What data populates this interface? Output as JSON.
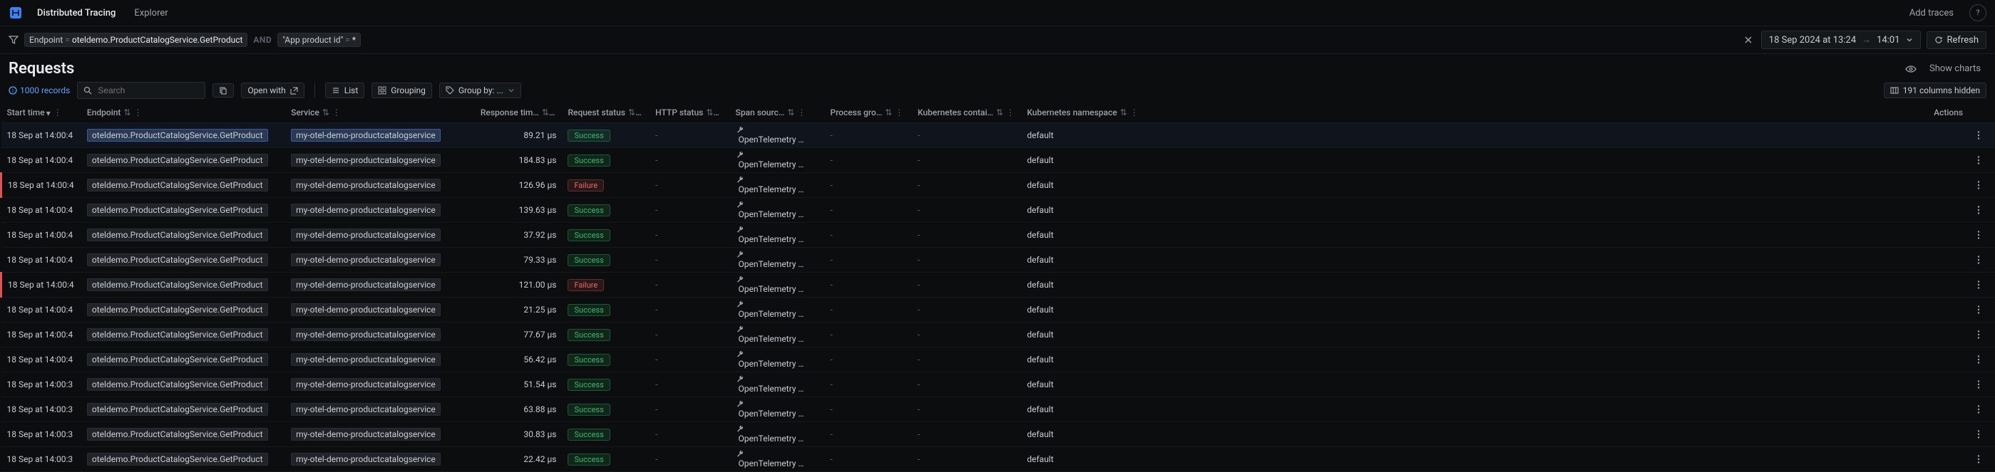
{
  "header": {
    "app": "Distributed Tracing",
    "explorer_tab": "Explorer",
    "add_traces": "Add traces"
  },
  "filter": {
    "endpoint_key": "Endpoint",
    "eq": "=",
    "endpoint_val": "oteldemo.ProductCatalogService.GetProduct",
    "and": "AND",
    "app_key": "\"App product id\"",
    "all": "*",
    "time_from": "18 Sep 2024 at 13:24",
    "time_to": "14:01",
    "arrow": "→",
    "refresh": "Refresh"
  },
  "page": {
    "title": "Requests",
    "record_count": "1000 records",
    "search_placeholder": "Search",
    "open_with": "Open with",
    "list": "List",
    "grouping": "Grouping",
    "group_by": "Group by: ...",
    "show_charts": "Show charts",
    "cols_hidden": "191 columns hidden"
  },
  "columns": {
    "start": "Start time",
    "endpoint": "Endpoint",
    "service": "Service",
    "response": "Response tim…",
    "req_status": "Request status",
    "http_status": "HTTP status",
    "span": "Span sourc…",
    "proc": "Process gro…",
    "kcon": "Kubernetes contai…",
    "kns": "Kubernetes namespace",
    "actions": "Actions"
  },
  "badges": {
    "success": "Success",
    "failure": "Failure"
  },
  "common": {
    "span_source": "OpenTelemetry …",
    "dash": "-",
    "namespace": "default"
  },
  "rows": [
    {
      "start": "18 Sep at 14:00:4",
      "endpoint": "oteldemo.ProductCatalogService.GetProduct",
      "service": "my-otel-demo-productcatalogservice",
      "resp": "89.21 µs",
      "status": "Success",
      "error": false,
      "selected": true
    },
    {
      "start": "18 Sep at 14:00:4",
      "endpoint": "oteldemo.ProductCatalogService.GetProduct",
      "service": "my-otel-demo-productcatalogservice",
      "resp": "184.83 µs",
      "status": "Success",
      "error": false
    },
    {
      "start": "18 Sep at 14:00:4",
      "endpoint": "oteldemo.ProductCatalogService.GetProduct",
      "service": "my-otel-demo-productcatalogservice",
      "resp": "126.96 µs",
      "status": "Failure",
      "error": true
    },
    {
      "start": "18 Sep at 14:00:4",
      "endpoint": "oteldemo.ProductCatalogService.GetProduct",
      "service": "my-otel-demo-productcatalogservice",
      "resp": "139.63 µs",
      "status": "Success",
      "error": false
    },
    {
      "start": "18 Sep at 14:00:4",
      "endpoint": "oteldemo.ProductCatalogService.GetProduct",
      "service": "my-otel-demo-productcatalogservice",
      "resp": "37.92 µs",
      "status": "Success",
      "error": false
    },
    {
      "start": "18 Sep at 14:00:4",
      "endpoint": "oteldemo.ProductCatalogService.GetProduct",
      "service": "my-otel-demo-productcatalogservice",
      "resp": "79.33 µs",
      "status": "Success",
      "error": false
    },
    {
      "start": "18 Sep at 14:00:4",
      "endpoint": "oteldemo.ProductCatalogService.GetProduct",
      "service": "my-otel-demo-productcatalogservice",
      "resp": "121.00 µs",
      "status": "Failure",
      "error": true
    },
    {
      "start": "18 Sep at 14:00:4",
      "endpoint": "oteldemo.ProductCatalogService.GetProduct",
      "service": "my-otel-demo-productcatalogservice",
      "resp": "21.25 µs",
      "status": "Success",
      "error": false
    },
    {
      "start": "18 Sep at 14:00:4",
      "endpoint": "oteldemo.ProductCatalogService.GetProduct",
      "service": "my-otel-demo-productcatalogservice",
      "resp": "77.67 µs",
      "status": "Success",
      "error": false
    },
    {
      "start": "18 Sep at 14:00:4",
      "endpoint": "oteldemo.ProductCatalogService.GetProduct",
      "service": "my-otel-demo-productcatalogservice",
      "resp": "56.42 µs",
      "status": "Success",
      "error": false
    },
    {
      "start": "18 Sep at 14:00:3",
      "endpoint": "oteldemo.ProductCatalogService.GetProduct",
      "service": "my-otel-demo-productcatalogservice",
      "resp": "51.54 µs",
      "status": "Success",
      "error": false
    },
    {
      "start": "18 Sep at 14:00:3",
      "endpoint": "oteldemo.ProductCatalogService.GetProduct",
      "service": "my-otel-demo-productcatalogservice",
      "resp": "63.88 µs",
      "status": "Success",
      "error": false
    },
    {
      "start": "18 Sep at 14:00:3",
      "endpoint": "oteldemo.ProductCatalogService.GetProduct",
      "service": "my-otel-demo-productcatalogservice",
      "resp": "30.83 µs",
      "status": "Success",
      "error": false
    },
    {
      "start": "18 Sep at 14:00:3",
      "endpoint": "oteldemo.ProductCatalogService.GetProduct",
      "service": "my-otel-demo-productcatalogservice",
      "resp": "22.42 µs",
      "status": "Success",
      "error": false
    }
  ]
}
